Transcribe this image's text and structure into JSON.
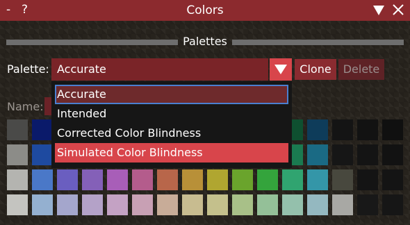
{
  "window": {
    "title": "Colors",
    "minimize_label": "-",
    "help_label": "?",
    "collapse_icon": "triangle-down-icon",
    "close_icon": "close-icon"
  },
  "palettes_section": {
    "label": "Palettes"
  },
  "palette_row": {
    "label": "Palette:",
    "selected": "Accurate",
    "clone_label": "Clone",
    "delete_label": "Delete",
    "dropdown_arrow_icon": "triangle-down-icon"
  },
  "name_row": {
    "label": "Name:"
  },
  "dropdown": {
    "options": [
      "Accurate",
      "Intended",
      "Corrected Color Blindness",
      "Simulated Color Blindness"
    ],
    "selected_index": 0,
    "hovered_index": 3
  },
  "swatches": [
    [
      "#4a4a48",
      "#0a1a6a",
      "#201a5e",
      "#3a1a58",
      "#4a185a",
      "#5a1a40",
      "#5a2418",
      "#5a4210",
      "#505010",
      "#2a5010",
      "#105018",
      "#0e5030",
      "#0e3c5a",
      "#141414",
      "#121212",
      "#101010"
    ],
    [
      "#8c8c88",
      "#1e4aa0",
      "#3a2c96",
      "#5a2c8c",
      "#7a2c8a",
      "#8a2c62",
      "#8a3c20",
      "#8a6618",
      "#807a18",
      "#447a18",
      "#1a7a28",
      "#1a7a50",
      "#1a6a84",
      "#161616",
      "#141414",
      "#121212"
    ],
    [
      "#b4b4b0",
      "#4a78c8",
      "#6a5ec0",
      "#8460b8",
      "#a85eb8",
      "#b45c8c",
      "#b8664a",
      "#b89038",
      "#b0a630",
      "#6aa42c",
      "#34a43c",
      "#30a470",
      "#3496a8",
      "#48483e",
      "#141414",
      "#141414"
    ],
    [
      "#c4c4c0",
      "#94b0d0",
      "#a4a6cc",
      "#b4a2c8",
      "#c4a2c4",
      "#c8a0b4",
      "#c8ac98",
      "#c8bc90",
      "#c4c08c",
      "#a8c088",
      "#94c098",
      "#94c0ac",
      "#94b8c0",
      "#a8a8a4",
      "#181818",
      "#161616"
    ]
  ]
}
